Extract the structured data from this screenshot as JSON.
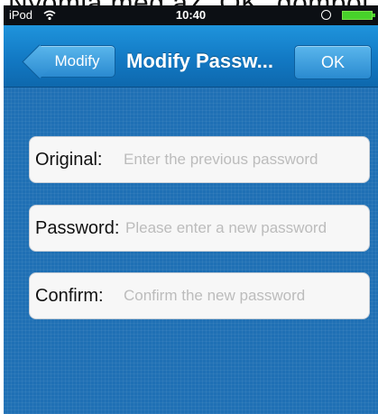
{
  "caption": "Nyomja meg az „OK” gombot",
  "status_bar": {
    "carrier": "iPod",
    "time": "10:40"
  },
  "nav": {
    "back_label": "Modify",
    "title": "Modify Passw...",
    "ok_label": "OK"
  },
  "form": {
    "original": {
      "label": "Original:",
      "placeholder": "Enter the previous password",
      "value": ""
    },
    "password": {
      "label": "Password:",
      "placeholder": "Please enter a new password",
      "value": ""
    },
    "confirm": {
      "label": "Confirm:",
      "placeholder": "Confirm the new password",
      "value": ""
    }
  },
  "icons": {
    "wifi": "wifi-icon",
    "lock": "rotation-lock-icon",
    "battery": "battery-icon"
  },
  "colors": {
    "nav": "#1279c4",
    "background": "#1f70b4",
    "battery": "#47d22a"
  }
}
